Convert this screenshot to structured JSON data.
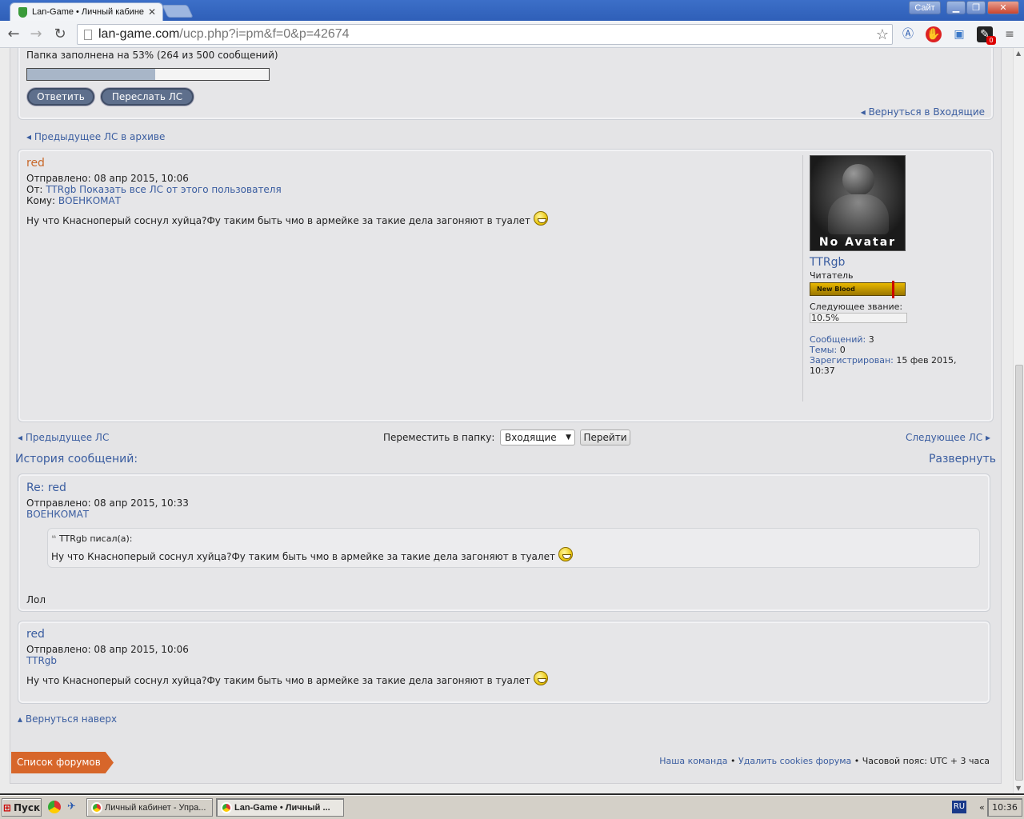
{
  "browser": {
    "tab_title": "Lan-Game • Личный кабине",
    "tab_close": "✕",
    "site_button": "Сайт",
    "url_domain": "lan-game.com",
    "url_path": "/ucp.php?i=pm&f=0&p=42674",
    "ext_badge": "0"
  },
  "folder": {
    "usage_text": "Папка заполнена на 53% (264 из 500 сообщений)",
    "usage_fraction": 0.53,
    "reply_button": "Ответить",
    "forward_button": "Переслать ЛС",
    "back_inbox": "Вернуться в Входящие",
    "prev_archive": "Предыдущее ЛС в архиве"
  },
  "message": {
    "subject": "red",
    "sent_label": "Отправлено:",
    "sent_date": "08 апр 2015, 10:06",
    "from_label": "От:",
    "from_user": "TTRgb",
    "show_all": "Показать все ЛС от этого пользователя",
    "to_label": "Кому:",
    "to_user": "ВОЕНКОМАТ",
    "body": "Ну что Кнасноперый соснул хуйца?Фу таким быть чмо в армейке за такие дела загоняют в туалет"
  },
  "profile": {
    "avatar_label": "No Avatar",
    "username": "TTRgb",
    "rank": "Читатель",
    "rank_badge": "New Blood",
    "next_rank_label": "Следующее звание:",
    "next_rank_value": "10.5%",
    "posts_label": "Сообщений:",
    "posts_value": "3",
    "topics_label": "Темы:",
    "topics_value": "0",
    "registered_label": "Зарегистрирован:",
    "registered_value": "15 фев 2015,",
    "registered_time": "10:37"
  },
  "pager": {
    "prev": "Предыдущее ЛС",
    "move_label": "Переместить в папку:",
    "folder_select": "Входящие",
    "go_button": "Перейти",
    "next": "Следующее ЛС"
  },
  "history": {
    "title": "История сообщений:",
    "expand": "Развернуть",
    "items": [
      {
        "subject": "Re: red",
        "sent": "Отправлено: 08 апр 2015, 10:33",
        "author": "ВОЕНКОМАТ",
        "quote_author": "TTRgb писал(а):",
        "quote_text": "Ну что Кнасноперый соснул хуйца?Фу таким быть чмо в армейке за такие дела загоняют в туалет",
        "body": "Лол"
      },
      {
        "subject": "red",
        "sent": "Отправлено: 08 апр 2015, 10:06",
        "author": "TTRgb",
        "body": "Ну что Кнасноперый соснул хуйца?Фу таким быть чмо в армейке за такие дела загоняют в туалет"
      }
    ]
  },
  "footer": {
    "back_top": "Вернуться наверх",
    "forum_list": "Список форумов",
    "team": "Наша команда",
    "delete_cookies": "Удалить cookies форума",
    "timezone": "Часовой пояс: UTC + 3 часа"
  },
  "taskbar": {
    "start": "Пуск",
    "task1": "Личный кабинет - Упра...",
    "task2": "Lan-Game • Личный ...",
    "lang": "RU",
    "chevron": "«",
    "clock": "10:36"
  }
}
